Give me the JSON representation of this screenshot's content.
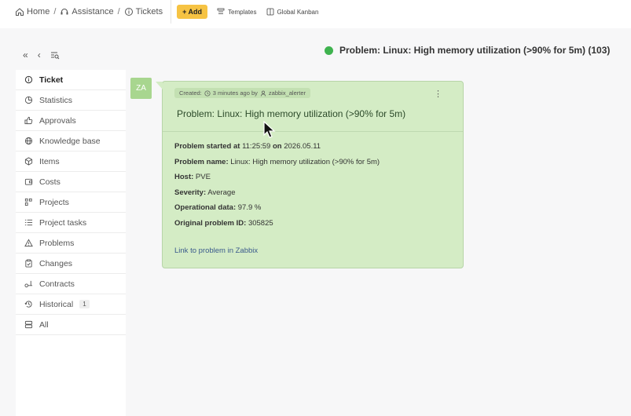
{
  "breadcrumb": {
    "home": "Home",
    "assistance": "Assistance",
    "tickets": "Tickets",
    "separator": "/"
  },
  "toolbar": {
    "add_label": "+ Add",
    "templates_label": "Templates",
    "kanban_label": "Global Kanban"
  },
  "header": {
    "title": "Problem: Linux: High memory utilization (>90% for 5m) (103)",
    "status_color": "#3fb34f"
  },
  "sidebar": {
    "items": [
      {
        "label": "Ticket",
        "icon": "info-circle-icon"
      },
      {
        "label": "Statistics",
        "icon": "pie-chart-icon"
      },
      {
        "label": "Approvals",
        "icon": "thumbs-up-icon"
      },
      {
        "label": "Knowledge base",
        "icon": "globe-icon"
      },
      {
        "label": "Items",
        "icon": "cube-icon"
      },
      {
        "label": "Costs",
        "icon": "wallet-icon"
      },
      {
        "label": "Projects",
        "icon": "projects-icon"
      },
      {
        "label": "Project tasks",
        "icon": "task-list-icon"
      },
      {
        "label": "Problems",
        "icon": "warning-triangle-icon"
      },
      {
        "label": "Changes",
        "icon": "clipboard-check-icon"
      },
      {
        "label": "Contracts",
        "icon": "contract-icon"
      },
      {
        "label": "Historical",
        "icon": "history-icon",
        "badge": "1"
      },
      {
        "label": "All",
        "icon": "stack-icon"
      }
    ]
  },
  "ticket": {
    "avatar": "ZA",
    "meta_created": "Created:",
    "meta_time": "3 minutes ago by",
    "meta_user": "zabbix_alerter",
    "title": "Problem: Linux: High memory utilization (>90% for 5m)",
    "started_label": "Problem started at",
    "started_time": "11:25:59",
    "on_label": "on",
    "started_date": "2026.05.11",
    "name_label": "Problem name:",
    "name_value": "Linux: High memory utilization (>90% for 5m)",
    "host_label": "Host:",
    "host_value": "PVE",
    "severity_label": "Severity:",
    "severity_value": "Average",
    "opdata_label": "Operational data:",
    "opdata_value": "97.9 %",
    "origid_label": "Original problem ID:",
    "origid_value": "305825",
    "link_label": "Link to problem in Zabbix"
  }
}
